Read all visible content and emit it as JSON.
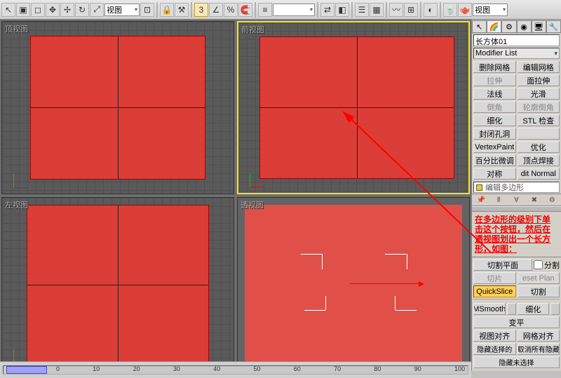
{
  "toolbar": {
    "viewmode1": "视图",
    "viewmode2": "视图",
    "number_badge": "3"
  },
  "viewports": {
    "top_left": {
      "label": "顶视图"
    },
    "top_right": {
      "label": "前视图"
    },
    "bottom_left": {
      "label": "左视图"
    },
    "bottom_right": {
      "label": "透视图"
    }
  },
  "panel": {
    "object_name": "长方体01",
    "modifier_list": "Modifier List",
    "buttons": {
      "delete_mesh": "删除网格",
      "edit_mesh": "编辑网格",
      "extrude": "拉伸",
      "face_extrude": "面拉伸",
      "normal": "法线",
      "smooth": "光滑",
      "bevel": "倒角",
      "outline_bevel": "轮廓倒角",
      "tessellate": "细化",
      "stl_check": "STL 检查",
      "cap_holes": "封闭孔洞",
      "flip": "",
      "vertex_paint": "VertexPaint",
      "optimize": "优化",
      "percent_adj": "百分比微调",
      "vertex_weld": "顶点焊接",
      "symmetry": "对称",
      "edit_normal": "dit Normal"
    },
    "stack_item": "编辑多边形",
    "annotation": "在多边形的级别下单击这个按钮，然后在透视图划出一个长方形，如图：",
    "slice_section": {
      "slice_plane": "切割平面",
      "split": "分割",
      "slice": "切片",
      "reset_plane": "eset Plan",
      "quickslice": "QuickSlice",
      "cut": "切割"
    },
    "msmooth": "MSmooth",
    "tessellate2": "细化",
    "make_planar": "变平",
    "view_align": "视图对齐",
    "grid_align": "网格对齐",
    "hide_sel": "隐藏选择的",
    "unhide_all": "取消所有隐藏",
    "hidden_select": "隐藏未选择"
  },
  "status": {
    "ticks": [
      "0",
      "10",
      "20",
      "30",
      "40",
      "50",
      "60",
      "70",
      "80",
      "90",
      "100"
    ]
  }
}
